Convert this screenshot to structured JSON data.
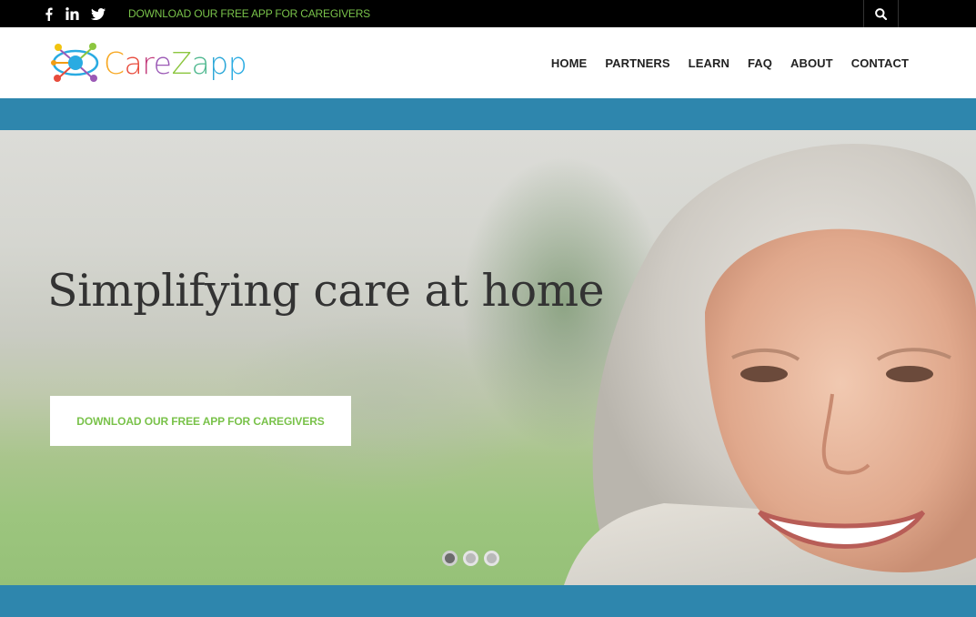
{
  "topbar": {
    "social_icons": [
      "facebook-icon",
      "linkedin-icon",
      "twitter-icon"
    ],
    "cta_text": "DOWNLOAD OUR FREE APP FOR CAREGIVERS",
    "search_icon": "search-icon"
  },
  "header": {
    "logo_text": {
      "c": "C",
      "a": "a",
      "r": "r",
      "e": "e",
      "z": "Z",
      "a2": "a",
      "p": "p",
      "p2": "p"
    },
    "nav": [
      {
        "label": "HOME"
      },
      {
        "label": "PARTNERS"
      },
      {
        "label": "LEARN"
      },
      {
        "label": "FAQ"
      },
      {
        "label": "ABOUT"
      },
      {
        "label": "CONTACT"
      }
    ]
  },
  "hero": {
    "title": "Simplifying care at home",
    "button_label": "DOWNLOAD OUR FREE APP FOR CAREGIVERS",
    "slides": {
      "count": 3,
      "active_index": 0
    }
  },
  "colors": {
    "accent_green": "#79c24a",
    "band_blue": "#2e86ad",
    "topbar": "#000000"
  }
}
